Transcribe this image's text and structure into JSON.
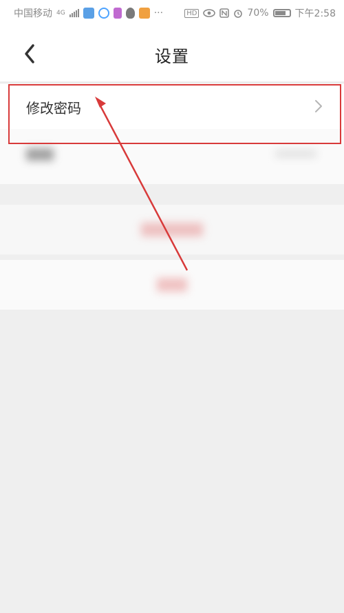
{
  "status_bar": {
    "carrier": "中国移动",
    "network": "4G",
    "ellipsis": "···",
    "hd_badge": "HD",
    "battery_percent": "70%",
    "time": "下午2:58",
    "icons": [
      "signal-icon",
      "app-icon",
      "circle-app-icon",
      "media-app-icon",
      "qq-icon",
      "video-app-icon",
      "eye-icon",
      "nfc-icon",
      "alarm-icon",
      "battery-icon"
    ]
  },
  "header": {
    "title": "设置",
    "back_icon": "chevron-left-icon"
  },
  "settings": {
    "items": [
      {
        "label": "修改密码",
        "icon": "chevron-right-icon"
      }
    ]
  },
  "annotation": {
    "color": "#d83a3a"
  }
}
